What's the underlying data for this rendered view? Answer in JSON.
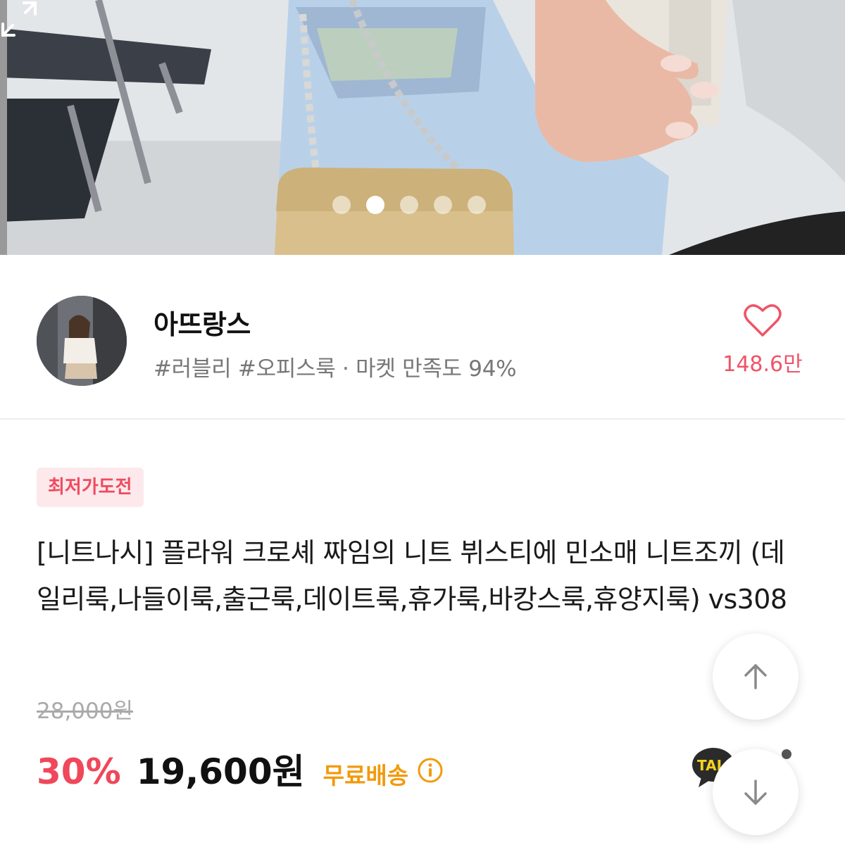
{
  "seller": {
    "name": "아뜨랑스",
    "tags": "#러블리 #오피스룩 · 마켓 만족도 94%",
    "likes": "148.6만"
  },
  "product": {
    "badge": "최저가도전",
    "title": "[니트나시] 플라워 크로셰 짜임의 니트 뷔스티에 민소매 니트조끼 (데일리룩,나들이룩,출근룩,데이트룩,휴가룩,바캉스룩,휴양지룩) vs308",
    "original_price": "28,000원",
    "discount": "30%",
    "price": "19,600원",
    "shipping": "무료배송"
  },
  "talk_button": {
    "label": "TALK"
  },
  "colors": {
    "accent": "#f0475a",
    "shipping": "#f29a0c",
    "badge_bg": "#fde9ec"
  },
  "carousel": {
    "total": 5,
    "active_index": 1
  }
}
